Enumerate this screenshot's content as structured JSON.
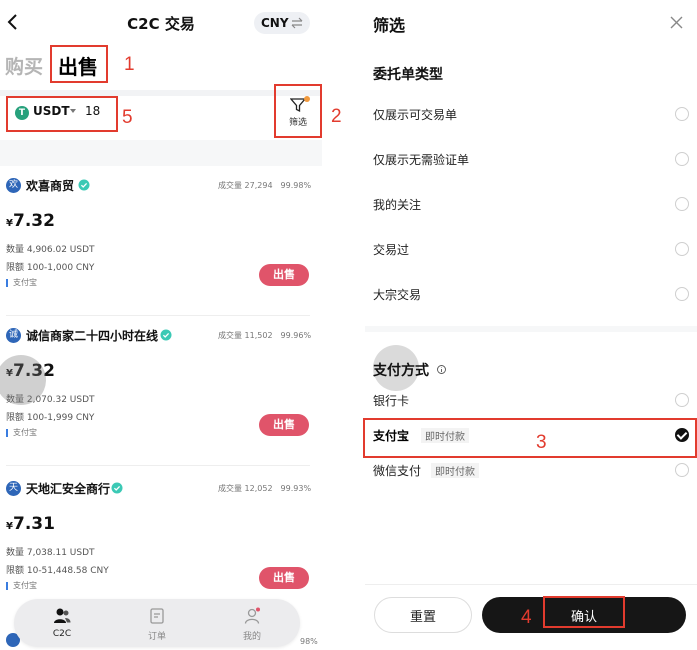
{
  "app": {
    "title": "C2C 交易",
    "currency": "CNY",
    "tabs": {
      "buy": "购买",
      "sell": "出售"
    }
  },
  "coin_selector": {
    "badge": "T",
    "coin": "USDT",
    "amount": "18"
  },
  "filter": {
    "label": "筛选"
  },
  "listings": [
    {
      "avatar": "欢",
      "merchant": "欢喜商贸",
      "volume": "成交量 27,294",
      "rate": "99.98%",
      "currency_symbol": "¥",
      "price": "7.32",
      "qty": "数量 4,906.02 USDT",
      "limit": "限额 100-1,000 CNY",
      "payment": "支付宝",
      "action": "出售"
    },
    {
      "avatar": "诚",
      "merchant": "诚信商家二十四小时在线",
      "volume": "成交量 11,502",
      "rate": "99.96%",
      "currency_symbol": "¥",
      "price": "7.32",
      "qty": "数量 2,070.32 USDT",
      "limit": "限额 100-1,999 CNY",
      "payment": "支付宝",
      "action": "出售"
    },
    {
      "avatar": "天",
      "merchant": "天地汇安全商行",
      "volume": "成交量 12,052",
      "rate": "99.93%",
      "currency_symbol": "¥",
      "price": "7.31",
      "qty": "数量 7,038.11 USDT",
      "limit": "限额 10-51,448.58 CNY",
      "payment": "支付宝",
      "action": "出售"
    }
  ],
  "bottom_peek": {
    "rate": "98%"
  },
  "bottom_nav": [
    {
      "label": "C2C"
    },
    {
      "label": "订单"
    },
    {
      "label": "我的"
    }
  ],
  "filter_panel": {
    "title": "筛选",
    "order_type_title": "委托单类型",
    "order_types": [
      "仅展示可交易单",
      "仅展示无需验证单",
      "我的关注",
      "交易过",
      "大宗交易"
    ],
    "payment_title": "支付方式",
    "payment_methods": [
      {
        "label": "银行卡",
        "tag": "",
        "selected": false
      },
      {
        "label": "支付宝",
        "tag": "即时付款",
        "selected": true
      },
      {
        "label": "微信支付",
        "tag": "即时付款",
        "selected": false
      }
    ],
    "reset": "重置",
    "confirm": "确认"
  },
  "annotations": [
    "1",
    "2",
    "3",
    "4",
    "5"
  ],
  "colors": {
    "sell_button": "#e0546a",
    "annotation": "#e23b2e",
    "usdt": "#27a17c",
    "confirm_button": "#161616"
  }
}
